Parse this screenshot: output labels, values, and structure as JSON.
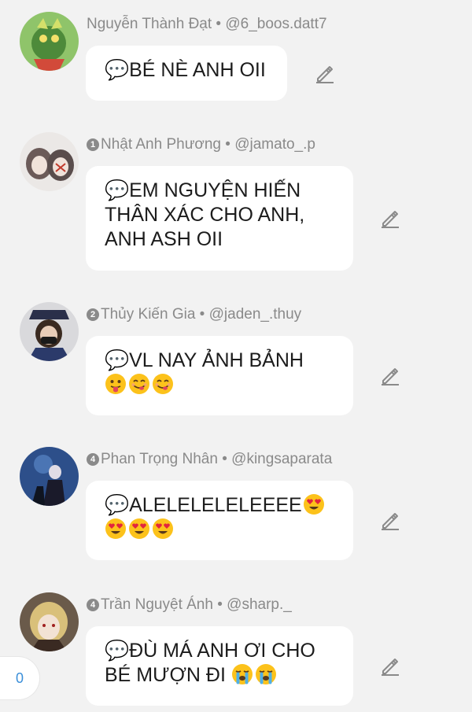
{
  "comments": [
    {
      "name": "Nguyễn Thành Đạt",
      "handle": "@6_boos.datt7",
      "rank": "",
      "text_lines": [
        "💬BÉ NÈ ANH OII"
      ],
      "emoji_line": []
    },
    {
      "name": "Nhật Anh Phương",
      "handle": "@jamato_.p",
      "rank": "1",
      "text_lines": [
        "💬EM NGUYỆN HIẾN",
        "THÂN XÁC CHO ANH,",
        "ANH ASH OII"
      ],
      "emoji_line": []
    },
    {
      "name": "Thủy Kiến Gia",
      "handle": "@jaden_.thuy",
      "rank": "2",
      "text_lines": [
        "💬VL NAY ẢNH BẢNH"
      ],
      "emoji_line": [
        "tongue",
        "yum",
        "yum"
      ]
    },
    {
      "name": "Phan Trọng Nhân",
      "handle": "@kingsaparata",
      "rank": "4",
      "text_lines": [
        "💬ALELELELELEEEE"
      ],
      "trailing_emoji": "heart-eyes",
      "emoji_line": [
        "heart-eyes",
        "heart-eyes",
        "heart-eyes"
      ]
    },
    {
      "name": "Trần Nguyệt Ánh",
      "handle": "@sharp._",
      "rank": "4",
      "text_lines": [
        "💬ĐÙ MÁ ANH ƠI CHO",
        "BÉ MƯỢN ĐI"
      ],
      "trailing_emoji_line2": [
        "sob",
        "sob"
      ],
      "emoji_line": []
    }
  ],
  "separator": " • ",
  "reaction_count": "0",
  "colors": {
    "background": "#f2f2f2",
    "bubble": "#ffffff",
    "meta_text": "#8a8a8a",
    "badge_text": "#3b8fd9"
  },
  "icons": {
    "edit": "pencil-icon",
    "speech": "speech-balloon"
  }
}
